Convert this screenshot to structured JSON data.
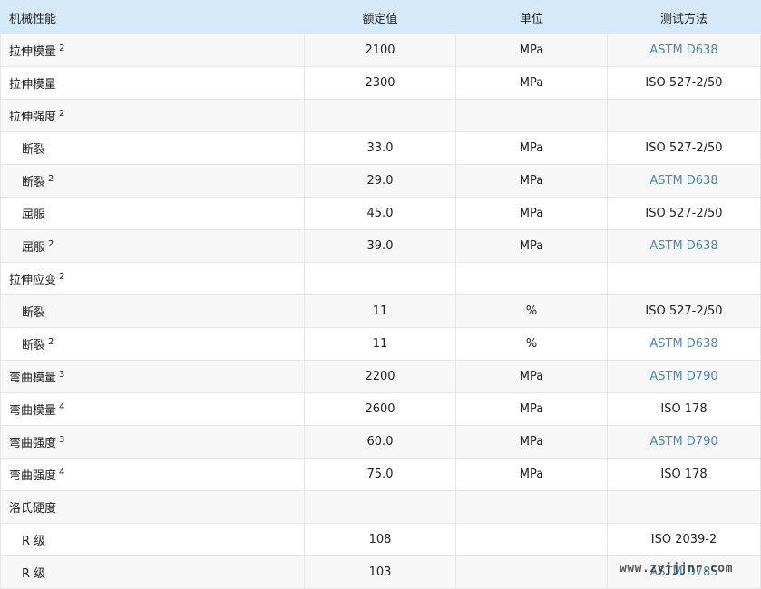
{
  "header": {
    "property": "机械性能",
    "value": "额定值",
    "unit": "单位",
    "method": "测试方法"
  },
  "rows": [
    {
      "label": "拉伸模量",
      "sup": "2",
      "indent": false,
      "value": "2100",
      "unit": "MPa",
      "method": "ASTM D638",
      "link": true
    },
    {
      "label": "拉伸模量",
      "sup": "",
      "indent": false,
      "value": "2300",
      "unit": "MPa",
      "method": "ISO 527-2/50",
      "link": false
    },
    {
      "label": "拉伸强度",
      "sup": "2",
      "indent": false,
      "value": "",
      "unit": "",
      "method": "",
      "link": false
    },
    {
      "label": "断裂",
      "sup": "",
      "indent": true,
      "value": "33.0",
      "unit": "MPa",
      "method": "ISO 527-2/50",
      "link": false
    },
    {
      "label": "断裂",
      "sup": "2",
      "indent": true,
      "value": "29.0",
      "unit": "MPa",
      "method": "ASTM D638",
      "link": true
    },
    {
      "label": "屈服",
      "sup": "",
      "indent": true,
      "value": "45.0",
      "unit": "MPa",
      "method": "ISO 527-2/50",
      "link": false
    },
    {
      "label": "屈服",
      "sup": "2",
      "indent": true,
      "value": "39.0",
      "unit": "MPa",
      "method": "ASTM D638",
      "link": true
    },
    {
      "label": "拉伸应变",
      "sup": "2",
      "indent": false,
      "value": "",
      "unit": "",
      "method": "",
      "link": false
    },
    {
      "label": "断裂",
      "sup": "",
      "indent": true,
      "value": "11",
      "unit": "%",
      "method": "ISO 527-2/50",
      "link": false
    },
    {
      "label": "断裂",
      "sup": "2",
      "indent": true,
      "value": "11",
      "unit": "%",
      "method": "ASTM D638",
      "link": true
    },
    {
      "label": "弯曲模量",
      "sup": "3",
      "indent": false,
      "value": "2200",
      "unit": "MPa",
      "method": "ASTM D790",
      "link": true
    },
    {
      "label": "弯曲模量",
      "sup": "4",
      "indent": false,
      "value": "2600",
      "unit": "MPa",
      "method": "ISO 178",
      "link": false
    },
    {
      "label": "弯曲强度",
      "sup": "3",
      "indent": false,
      "value": "60.0",
      "unit": "MPa",
      "method": "ASTM D790",
      "link": true
    },
    {
      "label": "弯曲强度",
      "sup": "4",
      "indent": false,
      "value": "75.0",
      "unit": "MPa",
      "method": "ISO 178",
      "link": false
    },
    {
      "label": "洛氏硬度",
      "sup": "",
      "indent": false,
      "value": "",
      "unit": "",
      "method": "",
      "link": false
    },
    {
      "label": "R 级",
      "sup": "",
      "indent": true,
      "value": "108",
      "unit": "",
      "method": "ISO 2039-2",
      "link": false
    },
    {
      "label": "R 级",
      "sup": "",
      "indent": true,
      "value": "103",
      "unit": "",
      "method": "ASTM D785",
      "link": true
    }
  ],
  "watermark": "www.zyjjjnr.com",
  "colors": {
    "header_bg": "#d6e9f9",
    "link": "#4b87b5",
    "row_alt": "#f7f7f7",
    "border": "#e6e6e6"
  }
}
